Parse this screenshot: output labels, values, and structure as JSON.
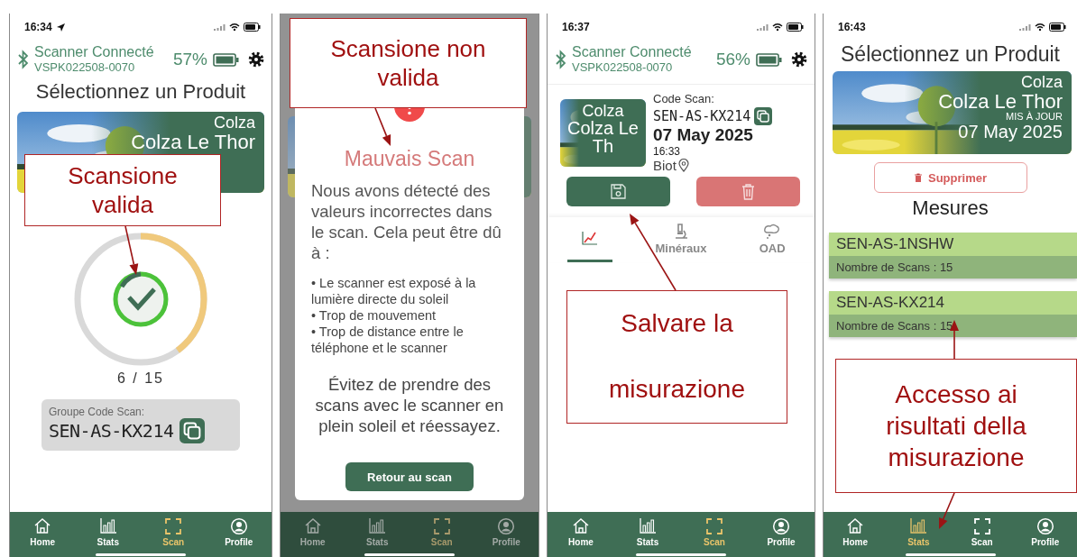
{
  "phones": [
    {
      "kind": "scan-progress",
      "dimmed": false,
      "status": {
        "time": "16:34",
        "location_on": true
      },
      "scanner": {
        "status": "Scanner Connecté",
        "id": "VSPK022508-0070",
        "battery": "57%"
      },
      "title": "Sélectionnez un Produit",
      "product": {
        "crop": "Colza",
        "name": "Colza Le Thor"
      },
      "progress": {
        "level": 0.4,
        "count": "6 / 15"
      },
      "code_group": {
        "label": "Groupe Code Scan:",
        "code": "SEN-AS-KX214"
      },
      "nav": [
        {
          "label": "Home",
          "selected": false
        },
        {
          "label": "Stats",
          "selected": false
        },
        {
          "label": "Scan",
          "selected": true
        },
        {
          "label": "Profile",
          "selected": false
        }
      ],
      "callout": "Scansione valida"
    },
    {
      "kind": "error-modal",
      "dimmed": true,
      "modal": {
        "title": "Mauvais Scan",
        "intro": "Nous avons détecté des valeurs incorrectes dans le scan. Cela peut être dû à :",
        "bullets": [
          "• Le scanner est exposé à la lumière directe du soleil",
          "• Trop de mouvement",
          "• Trop de distance entre le téléphone et le scanner"
        ],
        "advice": "Évitez de prendre des scans avec le scanner en plein soleil et réessayez.",
        "button": "Retour au scan"
      },
      "nav": [
        {
          "label": "Home",
          "selected": false
        },
        {
          "label": "Stats",
          "selected": false
        },
        {
          "label": "Scan",
          "selected": true
        },
        {
          "label": "Profile",
          "selected": false
        }
      ],
      "callout": "Scansione non valida"
    },
    {
      "kind": "scan-result",
      "dimmed": false,
      "status": {
        "time": "16:37",
        "location_on": false
      },
      "scanner": {
        "status": "Scanner Connecté",
        "id": "VSPK022508-0070",
        "battery": "56%"
      },
      "scan": {
        "crop": "Colza",
        "name": "Colza Le Th",
        "code_label": "Code Scan:",
        "code": "SEN-AS-KX214",
        "date": "07 May 2025",
        "time": "16:33",
        "place": "Biot"
      },
      "tabs": [
        {
          "selected": true
        },
        {
          "label": "Minéraux",
          "selected": false
        },
        {
          "label": "OAD",
          "selected": false
        }
      ],
      "nav": [
        {
          "label": "Home",
          "selected": false
        },
        {
          "label": "Stats",
          "selected": false
        },
        {
          "label": "Scan",
          "selected": true
        },
        {
          "label": "Profile",
          "selected": false
        }
      ],
      "callout": "Salvare la misurazione"
    },
    {
      "kind": "product-measures",
      "dimmed": false,
      "status": {
        "time": "16:43",
        "location_on": false
      },
      "title": "Sélectionnez un Produit",
      "product": {
        "crop": "Colza",
        "name": "Colza Le Thor",
        "updated_label": "MIS À JOUR",
        "date": "07 May 2025"
      },
      "delete_button": "Supprimer",
      "measures_heading": "Mesures",
      "measures": [
        {
          "code": "SEN-AS-1NSHW",
          "count": "Nombre de Scans : 15"
        },
        {
          "code": "SEN-AS-KX214",
          "count": "Nombre de Scans : 15"
        }
      ],
      "nav": [
        {
          "label": "Home",
          "selected": false
        },
        {
          "label": "Stats",
          "selected": true
        },
        {
          "label": "Scan",
          "selected": false
        },
        {
          "label": "Profile",
          "selected": false
        }
      ],
      "callout": "Accesso ai risultati della misurazione"
    }
  ]
}
